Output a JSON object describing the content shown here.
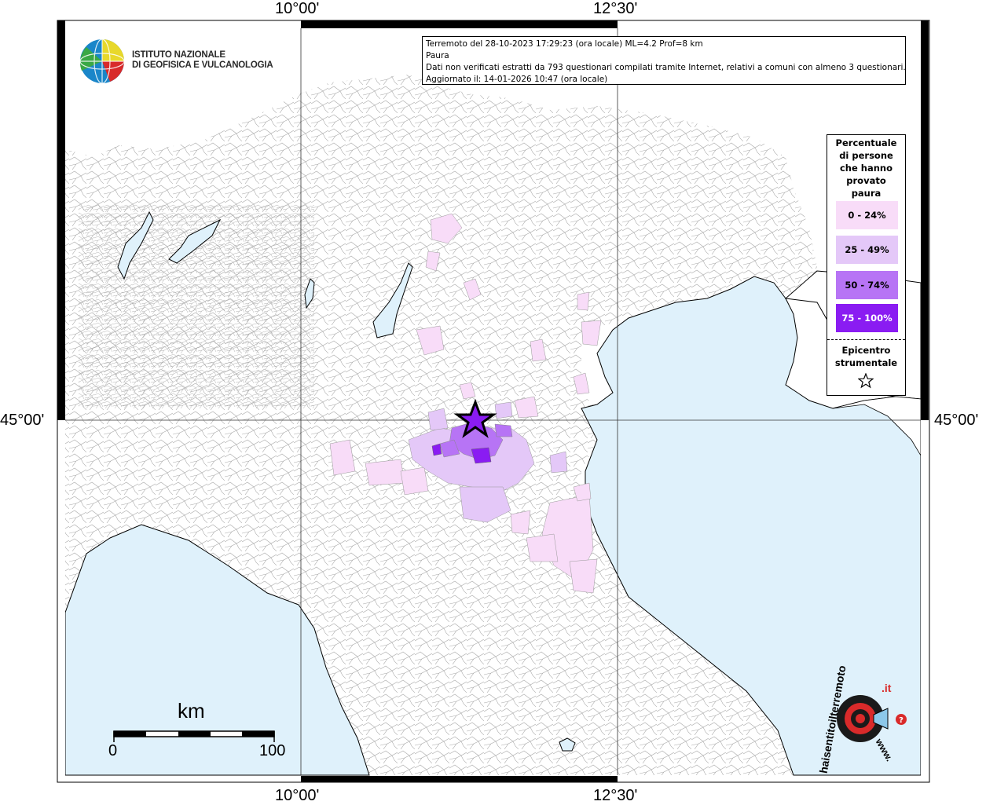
{
  "info": {
    "line1": "Terremoto del 28-10-2023 17:29:23 (ora locale) ML=4.2 Prof=8 km",
    "line2": "Paura",
    "line3": "Dati non verificati estratti da 793 questionari compilati tramite Internet, relativi a comuni con almeno 3 questionari.",
    "line4": "Aggiornato il: 14-01-2026 10:47 (ora locale)"
  },
  "logo": {
    "line1": "ISTITUTO NAZIONALE",
    "line2": "DI GEOFISICA E VULCANOLOGIA"
  },
  "coords": {
    "lon1": "10°00'",
    "lon2": "12°30'",
    "lat": "45°00'"
  },
  "legend": {
    "title_lines": [
      "Percentuale",
      "di persone",
      "che hanno",
      "provato",
      "paura"
    ],
    "items": [
      {
        "label": "0 - 24%",
        "color": "#f8dcf8"
      },
      {
        "label": "25 - 49%",
        "color": "#e4c8f8"
      },
      {
        "label": "50 - 74%",
        "color": "#b774f5"
      },
      {
        "label": "75 - 100%",
        "color": "#8a1cf2"
      }
    ],
    "epicentre_line1": "Epicentro",
    "epicentre_line2": "strumentale"
  },
  "scale": {
    "unit": "km",
    "min": "0",
    "max": "100"
  },
  "badge": {
    "text_left": "haisentitoilterremoto",
    "text_domain": ".it",
    "text_www": "www."
  },
  "colors": {
    "sea": "#dff1fb",
    "land": "#ffffff",
    "boundary": "#9a9a9a"
  }
}
